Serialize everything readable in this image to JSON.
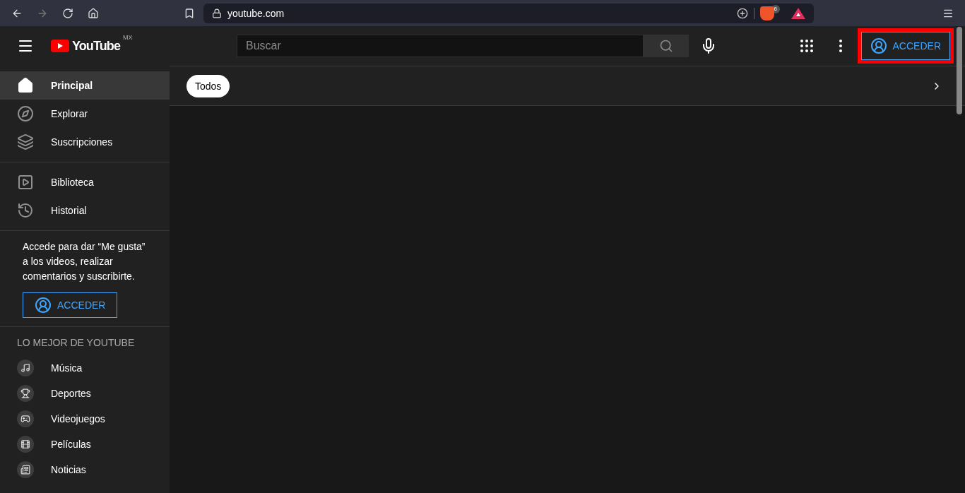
{
  "browser": {
    "url": "youtube.com",
    "shields_count": "6"
  },
  "header": {
    "logo_text": "YouTube",
    "country": "MX",
    "search": {
      "placeholder": "Buscar"
    },
    "sign_in": {
      "label": "ACCEDER",
      "highlighted": true
    }
  },
  "chips": [
    {
      "label": "Todos",
      "selected": true
    }
  ],
  "sidebar": {
    "sections": [
      {
        "items": [
          {
            "label": "Principal",
            "kind": "home",
            "selected": true
          },
          {
            "label": "Explorar",
            "kind": "compass",
            "selected": false
          },
          {
            "label": "Suscripciones",
            "kind": "subs",
            "selected": false
          }
        ]
      },
      {
        "items": [
          {
            "label": "Biblioteca",
            "kind": "library",
            "selected": false
          },
          {
            "label": "Historial",
            "kind": "history",
            "selected": false
          }
        ]
      }
    ],
    "sign_in_prompt": {
      "text": "Accede para dar “Me gusta” a los videos, realizar comentarios y suscribirte.",
      "button": "ACCEDER"
    },
    "best_of": {
      "title": "LO MEJOR DE YOUTUBE",
      "items": [
        {
          "label": "Música",
          "kind": "music",
          "selected": false
        },
        {
          "label": "Deportes",
          "kind": "trophy",
          "selected": false
        },
        {
          "label": "Videojuegos",
          "kind": "gamepad",
          "selected": false
        },
        {
          "label": "Películas",
          "kind": "film",
          "selected": false
        },
        {
          "label": "Noticias",
          "kind": "news",
          "selected": false
        }
      ]
    }
  }
}
